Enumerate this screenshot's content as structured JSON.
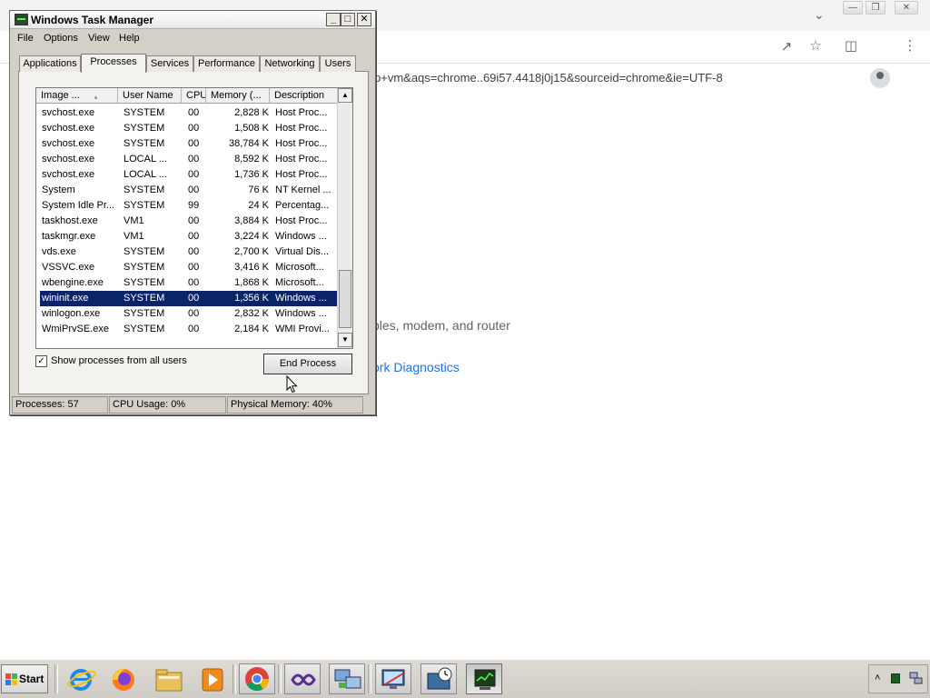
{
  "browser": {
    "url_fragment": "p+vm&aqs=chrome..69i57.4418j0j15&sourceid=chrome&ie=UTF-8",
    "page_text": "bles, modem, and router",
    "page_link": "ork Diagnostics"
  },
  "taskmgr": {
    "title": "Windows Task Manager",
    "menu": [
      "File",
      "Options",
      "View",
      "Help"
    ],
    "tabs": [
      "Applications",
      "Processes",
      "Services",
      "Performance",
      "Networking",
      "Users"
    ],
    "active_tab": "Processes",
    "columns": [
      "Image ...",
      "User Name",
      "CPU",
      "Memory (...",
      "Description"
    ],
    "rows": [
      {
        "name": "svchost.exe",
        "user": "SYSTEM",
        "cpu": "00",
        "mem": "2,828 K",
        "desc": "Host Proc..."
      },
      {
        "name": "svchost.exe",
        "user": "SYSTEM",
        "cpu": "00",
        "mem": "1,508 K",
        "desc": "Host Proc..."
      },
      {
        "name": "svchost.exe",
        "user": "SYSTEM",
        "cpu": "00",
        "mem": "38,784 K",
        "desc": "Host Proc..."
      },
      {
        "name": "svchost.exe",
        "user": "LOCAL ...",
        "cpu": "00",
        "mem": "8,592 K",
        "desc": "Host Proc..."
      },
      {
        "name": "svchost.exe",
        "user": "LOCAL ...",
        "cpu": "00",
        "mem": "1,736 K",
        "desc": "Host Proc..."
      },
      {
        "name": "System",
        "user": "SYSTEM",
        "cpu": "00",
        "mem": "76 K",
        "desc": "NT Kernel ..."
      },
      {
        "name": "System Idle Pr...",
        "user": "SYSTEM",
        "cpu": "99",
        "mem": "24 K",
        "desc": "Percentag..."
      },
      {
        "name": "taskhost.exe",
        "user": "VM1",
        "cpu": "00",
        "mem": "3,884 K",
        "desc": "Host Proc..."
      },
      {
        "name": "taskmgr.exe",
        "user": "VM1",
        "cpu": "00",
        "mem": "3,224 K",
        "desc": "Windows ..."
      },
      {
        "name": "vds.exe",
        "user": "SYSTEM",
        "cpu": "00",
        "mem": "2,700 K",
        "desc": "Virtual Dis..."
      },
      {
        "name": "VSSVC.exe",
        "user": "SYSTEM",
        "cpu": "00",
        "mem": "3,416 K",
        "desc": "Microsoft..."
      },
      {
        "name": "wbengine.exe",
        "user": "SYSTEM",
        "cpu": "00",
        "mem": "1,868 K",
        "desc": "Microsoft..."
      },
      {
        "name": "wininit.exe",
        "user": "SYSTEM",
        "cpu": "00",
        "mem": "1,356 K",
        "desc": "Windows ...",
        "selected": true
      },
      {
        "name": "winlogon.exe",
        "user": "SYSTEM",
        "cpu": "00",
        "mem": "2,832 K",
        "desc": "Windows ..."
      },
      {
        "name": "WmiPrvSE.exe",
        "user": "SYSTEM",
        "cpu": "00",
        "mem": "2,184 K",
        "desc": "WMI Provi..."
      }
    ],
    "show_all_label": "Show processes from all users",
    "show_all_checked": true,
    "end_process_label": "End Process",
    "status": {
      "processes": "Processes: 57",
      "cpu": "CPU Usage: 0%",
      "memory": "Physical Memory: 40%"
    }
  },
  "taskbar": {
    "start_label": "Start",
    "icons": [
      "internet-explorer-icon",
      "firefox-icon",
      "file-explorer-icon",
      "media-player-icon",
      "chrome-icon",
      "visual-studio-icon",
      "network-icon",
      "remote-desktop-icon",
      "scheduler-icon",
      "task-manager-icon"
    ]
  },
  "colors": {
    "selection": "#0a246a",
    "window_face": "#d4d0c8",
    "link": "#1a73e8"
  }
}
